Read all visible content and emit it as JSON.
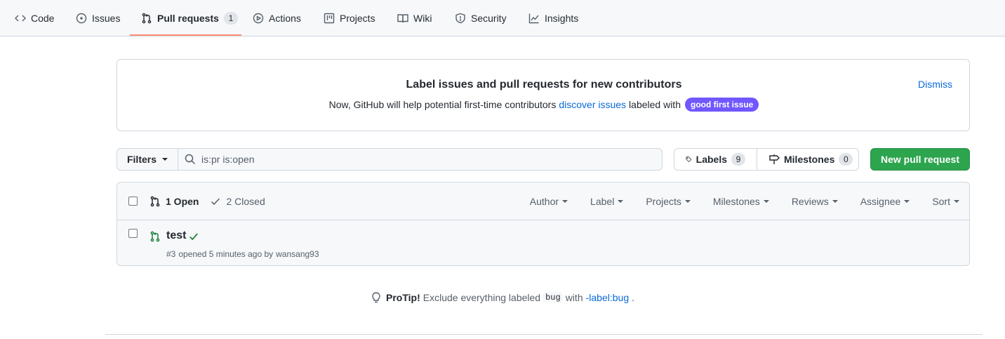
{
  "nav": {
    "tabs": [
      {
        "label": "Code",
        "icon": "code-icon"
      },
      {
        "label": "Issues",
        "icon": "issue-opened-icon"
      },
      {
        "label": "Pull requests",
        "icon": "git-pull-request-icon",
        "count": "1",
        "selected": true
      },
      {
        "label": "Actions",
        "icon": "play-icon"
      },
      {
        "label": "Projects",
        "icon": "table-icon"
      },
      {
        "label": "Wiki",
        "icon": "book-icon"
      },
      {
        "label": "Security",
        "icon": "shield-icon"
      },
      {
        "label": "Insights",
        "icon": "graph-icon"
      }
    ],
    "selected_underline_color": "#fd8c73"
  },
  "banner": {
    "title": "Label issues and pull requests for new contributors",
    "text_before": "Now, GitHub will help potential first-time contributors",
    "link_text": "discover issues",
    "text_after": "labeled with",
    "label": "good first issue",
    "label_color": "#7057ff",
    "dismiss": "Dismiss"
  },
  "toolbar": {
    "filters_label": "Filters",
    "search_value": "is:pr is:open",
    "labels_label": "Labels",
    "labels_count": "9",
    "milestones_label": "Milestones",
    "milestones_count": "0",
    "new_pr_label": "New pull request",
    "new_pr_color": "#2da44e"
  },
  "list": {
    "open_label": "1 Open",
    "closed_label": "2 Closed",
    "sort_filters": [
      "Author",
      "Label",
      "Projects",
      "Milestones",
      "Reviews",
      "Assignee",
      "Sort"
    ],
    "items": [
      {
        "title": "test",
        "status": "check-icon",
        "number": "#3",
        "opened_text": "opened 5 minutes ago by",
        "author": "wansang93"
      }
    ]
  },
  "protip": {
    "label": "ProTip!",
    "text": "Exclude everything labeled",
    "code": "bug",
    "with": "with",
    "link": "-label:bug",
    "period": "."
  }
}
